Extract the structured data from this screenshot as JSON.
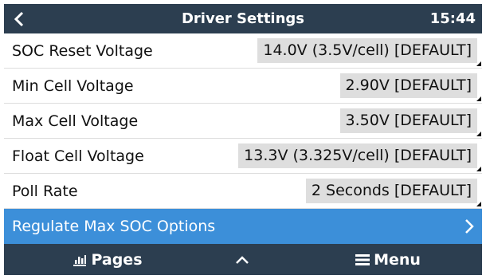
{
  "header": {
    "title": "Driver Settings",
    "time": "15:44",
    "back_icon": "chevron-left-icon"
  },
  "settings": [
    {
      "label": "SOC Reset Voltage",
      "value": "14.0V (3.5V/cell) [DEFAULT]"
    },
    {
      "label": "Min Cell Voltage",
      "value": "2.90V [DEFAULT]"
    },
    {
      "label": "Max Cell Voltage",
      "value": "3.50V [DEFAULT]"
    },
    {
      "label": "Float Cell Voltage",
      "value": "13.3V (3.325V/cell) [DEFAULT]"
    },
    {
      "label": "Poll Rate",
      "value": "2 Seconds [DEFAULT]"
    }
  ],
  "submenu": {
    "label": "Regulate Max SOC Options",
    "arrow_icon": "chevron-right-icon"
  },
  "footer": {
    "pages_label": "Pages",
    "menu_label": "Menu",
    "pages_icon": "bar-chart-icon",
    "up_icon": "chevron-up-icon",
    "menu_icon": "hamburger-icon"
  },
  "colors": {
    "header_bg": "#2c3e50",
    "highlight_bg": "#3c8fd9",
    "value_bg": "#dedede"
  }
}
